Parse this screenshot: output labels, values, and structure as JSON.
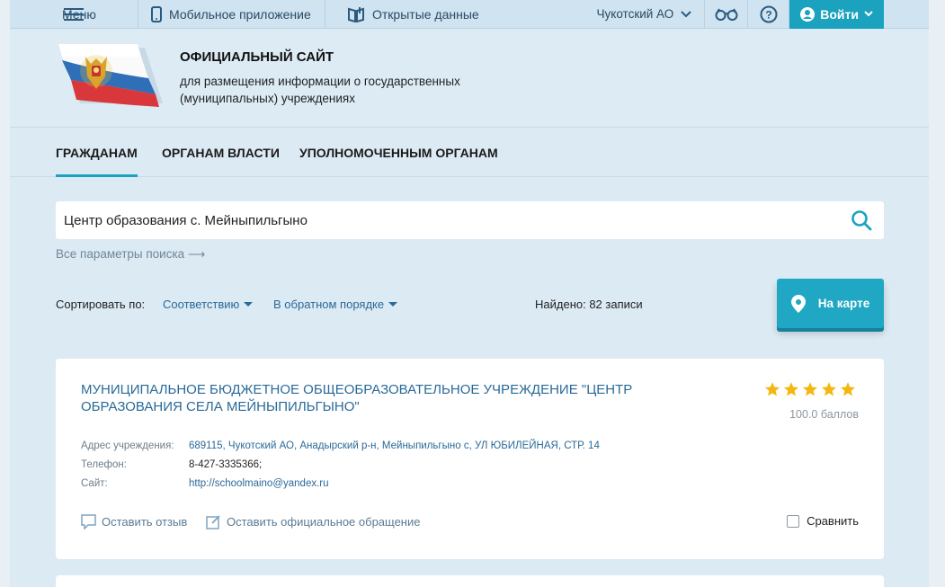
{
  "topbar": {
    "menu_label": "Меню",
    "mobile_label": "Мобильное приложение",
    "opendata_label": "Открытые данные",
    "region_label": "Чукотский АО",
    "login_label": "Войти"
  },
  "header": {
    "title": "ОФИЦИАЛЬНЫЙ САЙТ",
    "subtitle": "для размещения информации о государственных (муниципальных) учреждениях"
  },
  "nav": {
    "tabs": [
      {
        "label": "ГРАЖДАНАМ",
        "active": true
      },
      {
        "label": "ОРГАНАМ ВЛАСТИ",
        "active": false
      },
      {
        "label": "УПОЛНОМОЧЕННЫМ ОРГАНАМ",
        "active": false
      }
    ]
  },
  "search": {
    "value": "Центр образования с. Мейныпильгыно",
    "all_params": "Все параметры поиска ⟶"
  },
  "sort": {
    "label": "Сортировать по:",
    "relevance": "Соответствию",
    "order": "В обратном порядке",
    "found": "Найдено: 82 записи",
    "map_button": "На карте"
  },
  "result": {
    "title": "МУНИЦИПАЛЬНОЕ БЮДЖЕТНОЕ ОБЩЕОБРАЗОВАТЕЛЬНОЕ УЧРЕЖДЕНИЕ \"ЦЕНТР ОБРАЗОВАНИЯ СЕЛА МЕЙНЫПИЛЬГЫНО\"",
    "rating_stars": 5,
    "score": "100.0 баллов",
    "address_label": "Адрес учреждения:",
    "address_value": "689115, Чукотский АО, Анадырский р-н, Мейныпильгыно с, УЛ ЮБИЛЕЙНАЯ, СТР. 14",
    "phone_label": "Телефон:",
    "phone_value": "8-427-3335366;",
    "site_label": "Сайт:",
    "site_value": "http://schoolmaino@yandex.ru",
    "review_label": "Оставить отзыв",
    "appeal_label": "Оставить официальное обращение",
    "compare_label": "Сравнить"
  },
  "colors": {
    "accent": "#1ba2bf",
    "link": "#2a6a98",
    "star": "#f5b70f",
    "page_bg": "#dceaf4"
  },
  "icons": [
    "menu-icon",
    "phone-icon",
    "open-data-icon",
    "chevron-down-icon",
    "glasses-icon",
    "help-icon",
    "user-icon",
    "search-icon",
    "map-pin-icon",
    "star-icon",
    "comment-icon",
    "edit-icon",
    "checkbox-icon"
  ]
}
